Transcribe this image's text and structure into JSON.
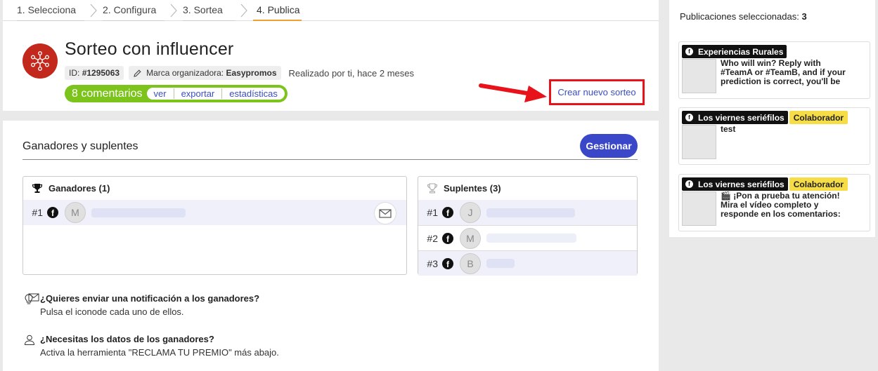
{
  "steps": [
    "1. Selecciona",
    "2. Configura",
    "3. Sortea",
    "4. Publica"
  ],
  "header": {
    "title": "Sorteo con influencer",
    "id_label": "ID:",
    "id_value": "#1295063",
    "brand_label": "Marca organizadora:",
    "brand_value": "Easypromos",
    "done_text": "Realizado por ti, hace 2 meses",
    "comments_text": "8 comentarios",
    "links": [
      "ver",
      "exportar",
      "estadísticas"
    ],
    "new_draw": "Crear nuevo sorteo"
  },
  "winners_section": {
    "title": "Ganadores y suplentes",
    "manage_button": "Gestionar",
    "winners": {
      "title": "Ganadores (1)",
      "rows": [
        {
          "num": "#1",
          "initial": "M"
        }
      ]
    },
    "substitutes": {
      "title": "Suplentes (3)",
      "rows": [
        {
          "num": "#1",
          "initial": "J"
        },
        {
          "num": "#2",
          "initial": "M"
        },
        {
          "num": "#3",
          "initial": "B"
        }
      ]
    }
  },
  "info": [
    {
      "question": "¿Quieres enviar una notificación a los ganadores?",
      "answer_before": "Pulsa el icono",
      "answer_after": "de cada uno de ellos."
    },
    {
      "question": "¿Necesitas los datos de los ganadores?",
      "answer": "Activa la herramienta \"RECLAMA TU PREMIO\" más abajo."
    }
  ],
  "sidebar": {
    "title": "Publicaciones seleccionadas:",
    "count": "3",
    "posts": [
      {
        "page": "Experiencias Rurales",
        "badge": "",
        "text": "Who will win? Reply with #TeamA or #TeamB, and if your prediction is correct, you'll be entered into the"
      },
      {
        "page": "Los viernes seriéfilos",
        "badge": "Colaborador",
        "text": "test"
      },
      {
        "page": "Los viernes seriéfilos",
        "badge": "Colaborador",
        "text": "🎬 ¡Pon a prueba tu atención! Mira el vídeo completo y responde en los comentarios: ¿De qué color es el"
      }
    ]
  },
  "colors": {
    "accent": "#3b47c9",
    "comments_green": "#7cc41c",
    "logo_red": "#c2281c",
    "highlight_red": "#e8121a",
    "collab_yellow": "#f6dd48"
  }
}
